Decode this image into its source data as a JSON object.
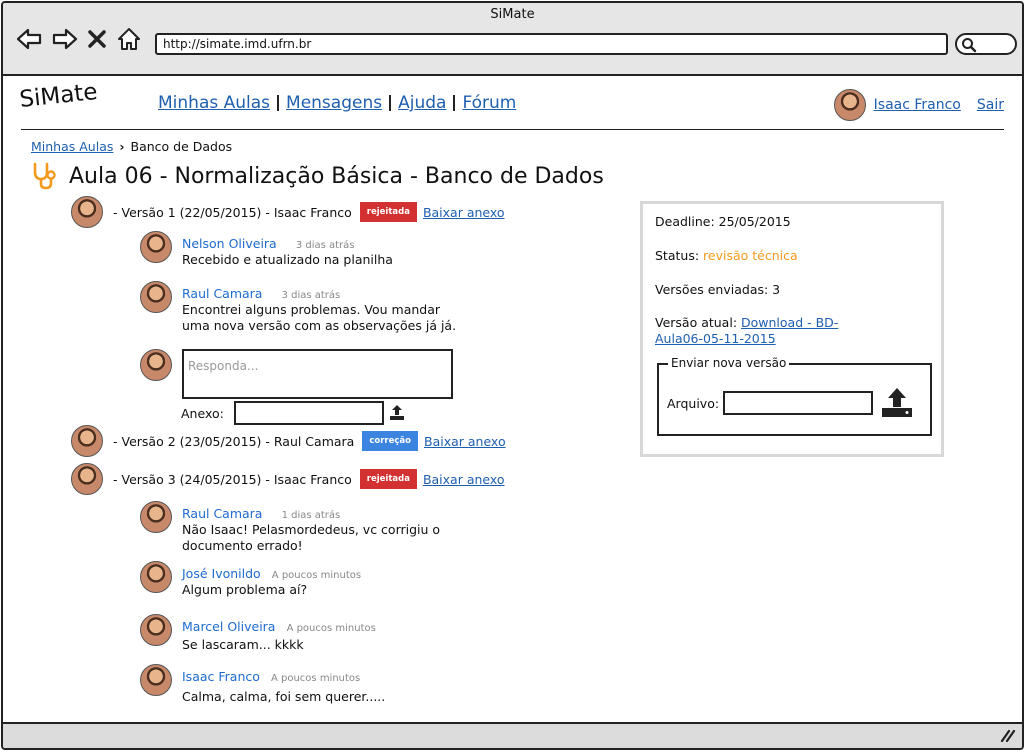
{
  "window": {
    "title": "SiMate",
    "url": "http://simate.imd.ufrn.br"
  },
  "header": {
    "logo": "SiMate",
    "menu": [
      "Minhas Aulas",
      "Mensagens",
      "Ajuda",
      "Fórum"
    ],
    "user_name": "Isaac Franco",
    "logout": "Sair"
  },
  "breadcrumb": {
    "link": "Minhas Aulas",
    "current": "Banco de Dados"
  },
  "page_title": "Aula 06 - Normalização Básica - Banco de Dados",
  "versions": [
    {
      "text": "- Versão 1 (22/05/2015) - Isaac Franco",
      "badge": "rejeitada",
      "badge_color": "#d33131",
      "action": "Baixar anexo"
    },
    {
      "text": "- Versão 2 (23/05/2015) - Raul Camara",
      "badge": "correção",
      "badge_color": "#3b84e0",
      "action": "Baixar anexo"
    },
    {
      "text": "- Versão 3 (24/05/2015) - Isaac Franco",
      "badge": "rejeitada",
      "badge_color": "#d33131",
      "action": "Baixar anexo"
    }
  ],
  "comments_v1": [
    {
      "name": "Nelson Oliveira",
      "time": "3 dias atrás",
      "text": "Recebido e atualizado na planilha"
    },
    {
      "name": "Raul Camara",
      "time": "3 dias atrás",
      "text": "Encontrei alguns problemas. Vou mandar uma nova versão com as observações já já."
    }
  ],
  "reply": {
    "placeholder": "Responda...",
    "attachment_label": "Anexo:"
  },
  "comments_v3": [
    {
      "name": "Raul Camara",
      "time": "1 dias atrás",
      "text": "Não Isaac! Pelasmordedeus, vc corrigiu o documento errado!"
    },
    {
      "name": "José Ivonildo",
      "time": "A poucos minutos",
      "text": "Algum problema aí?"
    },
    {
      "name": "Marcel Oliveira",
      "time": "A poucos minutos",
      "text": "Se lascaram... kkkk"
    },
    {
      "name": "Isaac Franco",
      "time": "A poucos minutos",
      "text": "Calma, calma, foi sem querer....."
    }
  ],
  "panel": {
    "deadline": "Deadline: 25/05/2015",
    "status_label": "Status:",
    "status_value": "revisão técnica",
    "status_color": "#f39a1e",
    "versions_sent": "Versões enviadas: 3",
    "current_label": "Versão atual:",
    "current_link_1": "Download - BD-",
    "current_link_2": "Aula06-05-11-2015",
    "upload_legend": "Enviar nova versão",
    "file_label": "Arquivo:"
  }
}
